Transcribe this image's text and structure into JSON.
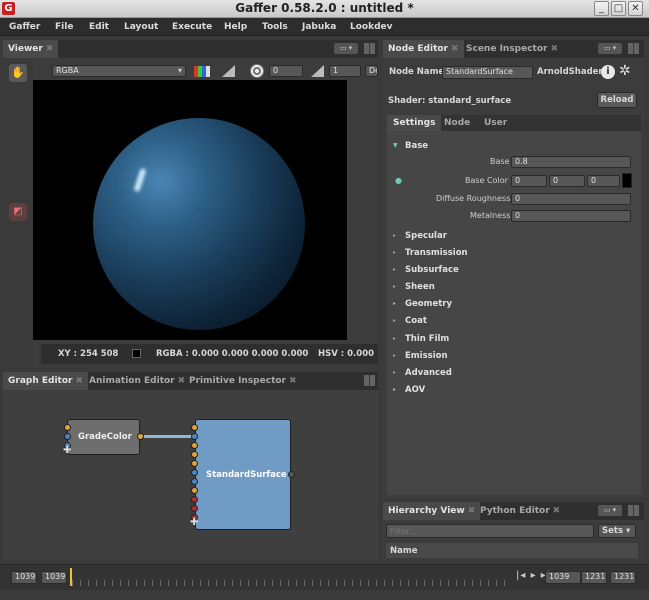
{
  "window": {
    "title": "Gaffer 0.58.2.0 : untitled *",
    "app_icon": "gaffer-icon",
    "buttons": [
      "_",
      "□",
      "✕"
    ]
  },
  "menu": [
    "Gaffer",
    "File",
    "Edit",
    "Layout",
    "Execute",
    "Help",
    "Tools",
    "Jabuka",
    "Lookdev"
  ],
  "viewer": {
    "tab": "Viewer",
    "channel": "RGBA",
    "exposure": "0",
    "gamma": "1",
    "display": "De",
    "status": {
      "xy": "XY : 254 508",
      "rgba": "RGBA : 0.000 0.000 0.000 0.000",
      "hsv": "HSV : 0.000"
    }
  },
  "node_editor": {
    "tabs": [
      "Node Editor",
      "Scene Inspector"
    ],
    "node_name_label": "Node Name",
    "node_name": "StandardSurface",
    "node_type": "ArnoldShader",
    "shader_label": "Shader: standard_surface",
    "reload": "Reload",
    "subtabs": [
      "Settings",
      "Node",
      "User"
    ],
    "base_section": "Base",
    "params": {
      "base_label": "Base",
      "base_value": "0.8",
      "base_color_label": "Base Color",
      "base_color": [
        "0",
        "0",
        "0"
      ],
      "swatch_color": "#000000",
      "diffuse_roughness_label": "Diffuse Roughness",
      "diffuse_roughness": "0",
      "metalness_label": "Metalness",
      "metalness": "0"
    },
    "sections": [
      "Specular",
      "Transmission",
      "Subsurface",
      "Sheen",
      "Geometry",
      "Coat",
      "Thin Film",
      "Emission",
      "Advanced",
      "AOV"
    ]
  },
  "graph_editor": {
    "tabs": [
      "Graph Editor",
      "Animation Editor",
      "Primitive Inspector"
    ],
    "nodes": {
      "grade": "GradeColor",
      "surface": "StandardSurface"
    }
  },
  "hierarchy": {
    "tabs": [
      "Hierarchy View",
      "Python Editor"
    ],
    "filter_placeholder": "Filter...",
    "sets": "Sets",
    "column": "Name"
  },
  "timeline": {
    "start_outer": "1039",
    "start_inner": "1039",
    "current": "1039",
    "end_inner": "1231",
    "end_outer": "1231"
  },
  "colors": {
    "accent_shader": "#6f9bc4",
    "node_grey": "#6e6e6e",
    "connection": "#8fb6d8"
  }
}
